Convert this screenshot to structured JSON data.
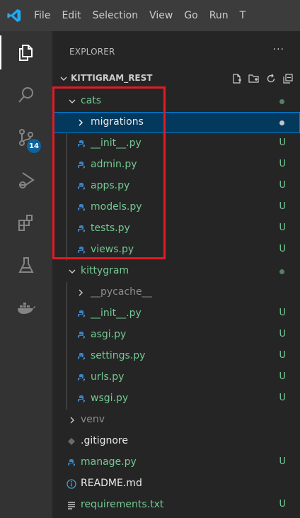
{
  "titlebar": {
    "menu": [
      "File",
      "Edit",
      "Selection",
      "View",
      "Go",
      "Run",
      "T"
    ]
  },
  "activity_bar": {
    "source_control_badge": "14",
    "icons": [
      "explorer-icon",
      "search-icon",
      "source-control-icon",
      "run-debug-icon",
      "extensions-icon",
      "testing-icon",
      "docker-icon"
    ]
  },
  "explorer": {
    "header": "EXPLORER",
    "more": "···",
    "folder_name": "KITTIGRAM_REST"
  },
  "tree": {
    "cats": {
      "label": "cats"
    },
    "migrations": {
      "label": "migrations"
    },
    "cats_init": {
      "label": "__init__.py",
      "status": "U"
    },
    "admin": {
      "label": "admin.py",
      "status": "U"
    },
    "apps": {
      "label": "apps.py",
      "status": "U"
    },
    "models": {
      "label": "models.py",
      "status": "U"
    },
    "tests": {
      "label": "tests.py",
      "status": "U"
    },
    "views": {
      "label": "views.py",
      "status": "U"
    },
    "kittygram": {
      "label": "kittygram"
    },
    "pycache": {
      "label": "__pycache__"
    },
    "kg_init": {
      "label": "__init__.py",
      "status": "U"
    },
    "asgi": {
      "label": "asgi.py",
      "status": "U"
    },
    "settings": {
      "label": "settings.py",
      "status": "U"
    },
    "urls": {
      "label": "urls.py",
      "status": "U"
    },
    "wsgi": {
      "label": "wsgi.py",
      "status": "U"
    },
    "venv": {
      "label": "venv"
    },
    "gitignore": {
      "label": ".gitignore"
    },
    "manage": {
      "label": "manage.py",
      "status": "U"
    },
    "readme": {
      "label": "README.md"
    },
    "requirements": {
      "label": "requirements.txt",
      "status": "U"
    }
  },
  "colors": {
    "untracked": "#73c991",
    "selection": "#04395e",
    "highlight_box": "#e01b24",
    "badge": "#0e639c"
  }
}
